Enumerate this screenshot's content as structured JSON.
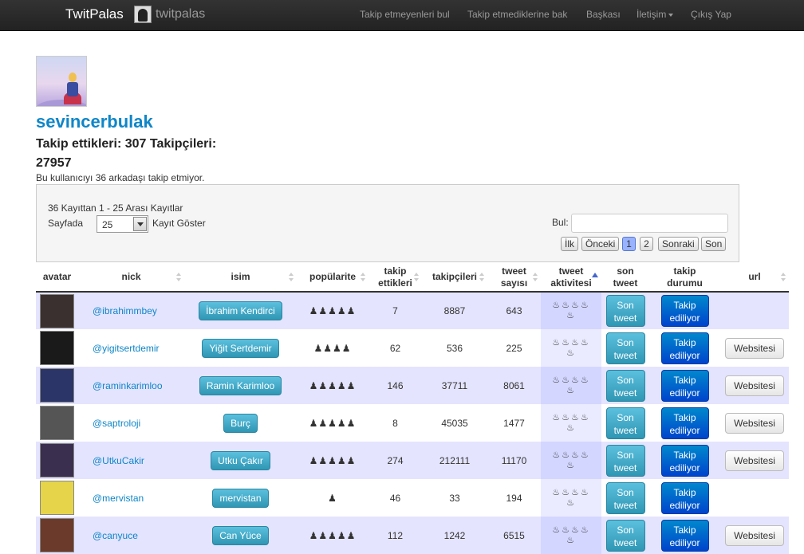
{
  "navbar": {
    "brand": "TwitPalas",
    "logo_text": "twitpalas",
    "links": [
      "Takip etmeyenleri bul",
      "Takip etmediklerine bak",
      "Başkası",
      "İletişim",
      "Çıkış Yap"
    ]
  },
  "profile": {
    "username": "sevincerbulak",
    "stats_line1": "Takip ettikleri: 307 Takipçileri:",
    "stats_line2": "27957",
    "notice": "Bu kullanıcıyı 36 arkadaşı takip etmiyor."
  },
  "controls": {
    "info": "36 Kayıttan 1 - 25 Arası Kayıtlar",
    "perpage_prefix": "Sayfada",
    "perpage_value": "25",
    "perpage_suffix": "Kayıt Göster",
    "search_label": "Bul:",
    "search_value": "",
    "pager": [
      "İlk",
      "Önceki",
      "1",
      "2",
      "Sonraki",
      "Son"
    ]
  },
  "table": {
    "headers": [
      "avatar",
      "nick",
      "isim",
      "popülarite",
      "takip ettikleri",
      "takipçileri",
      "tweet sayısı",
      "tweet aktivitesi",
      "son tweet",
      "takip durumu",
      "url"
    ],
    "header_lines": [
      [
        "avatar"
      ],
      [
        "nick"
      ],
      [
        "isim"
      ],
      [
        "popülarite"
      ],
      [
        "takip",
        "ettikleri"
      ],
      [
        "takipçileri"
      ],
      [
        "tweet",
        "sayısı"
      ],
      [
        "tweet",
        "aktivitesi"
      ],
      [
        "son",
        "tweet"
      ],
      [
        "takip",
        "durumu"
      ],
      [
        "url"
      ]
    ],
    "son_tweet_label": [
      "Son",
      "tweet"
    ],
    "takip_label": [
      "Takip",
      "ediliyor"
    ],
    "web_label": "Websitesi",
    "activity_icon": "flame-icon",
    "popularity_icon": "person-icon",
    "rows": [
      {
        "nick": "@ibrahimmbey",
        "isim": "İbrahim Kendirci",
        "pop": 5,
        "takip": "7",
        "takipci": "8887",
        "tweet": "643",
        "web": false,
        "avatar_color": "#3a3030"
      },
      {
        "nick": "@yigitsertdemir",
        "isim": "Yiğit Sertdemir",
        "pop": 4,
        "takip": "62",
        "takipci": "536",
        "tweet": "225",
        "web": true,
        "avatar_color": "#1a1a1a"
      },
      {
        "nick": "@raminkarimloo",
        "isim": "Ramin Karimloo",
        "pop": 5,
        "takip": "146",
        "takipci": "37711",
        "tweet": "8061",
        "web": true,
        "avatar_color": "#2b3568"
      },
      {
        "nick": "@saptroloji",
        "isim": "Burç",
        "pop": 5,
        "takip": "8",
        "takipci": "45035",
        "tweet": "1477",
        "web": true,
        "avatar_color": "#555555"
      },
      {
        "nick": "@UtkuCakir",
        "isim": "Utku Çakır",
        "pop": 5,
        "takip": "274",
        "takipci": "212111",
        "tweet": "11170",
        "web": true,
        "avatar_color": "#3a2f4f"
      },
      {
        "nick": "@mervistan",
        "isim": "mervistan",
        "pop": 1,
        "takip": "46",
        "takipci": "33",
        "tweet": "194",
        "web": false,
        "avatar_color": "#e6d44a"
      },
      {
        "nick": "@canyuce",
        "isim": "Can Yüce",
        "pop": 5,
        "takip": "112",
        "takipci": "1242",
        "tweet": "6515",
        "web": true,
        "avatar_color": "#6b3a2a"
      }
    ]
  }
}
